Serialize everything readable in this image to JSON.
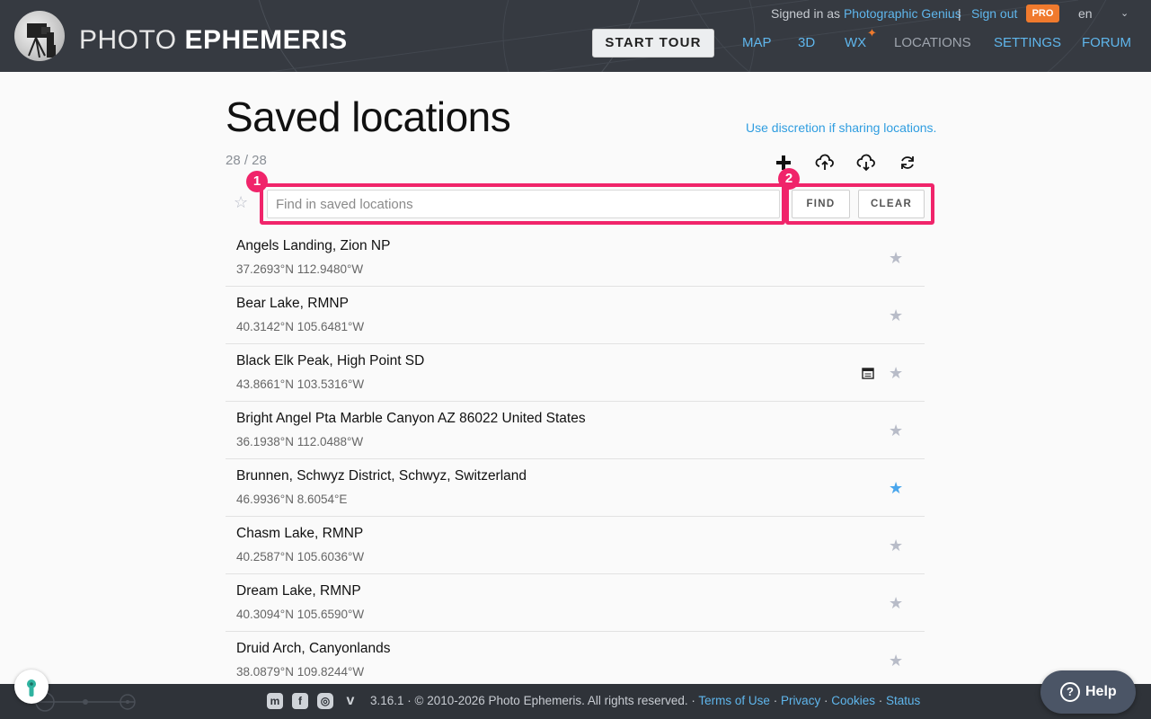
{
  "header": {
    "brand_light": "PHOTO",
    "brand_bold": "EPHEMERIS",
    "signed_in_prefix": "Signed in as",
    "user": "Photographic Genius",
    "separator": "|",
    "sign_out": "Sign out",
    "pro_badge": "PRO",
    "language": "en",
    "start_tour": "START TOUR",
    "nav": [
      {
        "label": "MAP",
        "active": false
      },
      {
        "label": "3D",
        "active": false
      },
      {
        "label": "WX",
        "active": false
      },
      {
        "label": "LOCATIONS",
        "active": true
      },
      {
        "label": "SETTINGS",
        "active": false
      },
      {
        "label": "FORUM",
        "active": false
      }
    ],
    "wx_new_marker": "✦"
  },
  "main": {
    "title": "Saved locations",
    "discretion_link": "Use discretion if sharing locations.",
    "count": "28 / 28",
    "toolbar_icons": [
      "plus-icon",
      "cloud-upload-icon",
      "cloud-download-icon",
      "refresh-icon"
    ],
    "search": {
      "placeholder": "Find in saved locations",
      "value": ""
    },
    "find_label": "FIND",
    "clear_label": "CLEAR",
    "annotations": [
      "1",
      "2"
    ]
  },
  "locations": [
    {
      "name": "Angels Landing, Zion NP",
      "coords": "37.2693°N 112.9480°W",
      "favorite": false,
      "calendar": false
    },
    {
      "name": "Bear Lake, RMNP",
      "coords": "40.3142°N 105.6481°W",
      "favorite": false,
      "calendar": false
    },
    {
      "name": "Black Elk Peak, High Point SD",
      "coords": "43.8661°N 103.5316°W",
      "favorite": false,
      "calendar": true
    },
    {
      "name": "Bright Angel Pta Marble Canyon AZ 86022 United States",
      "coords": "36.1938°N 112.0488°W",
      "favorite": false,
      "calendar": false
    },
    {
      "name": "Brunnen, Schwyz District, Schwyz, Switzerland",
      "coords": "46.9936°N 8.6054°E",
      "favorite": true,
      "calendar": false
    },
    {
      "name": "Chasm Lake, RMNP",
      "coords": "40.2587°N 105.6036°W",
      "favorite": false,
      "calendar": false
    },
    {
      "name": "Dream Lake, RMNP",
      "coords": "40.3094°N 105.6590°W",
      "favorite": false,
      "calendar": false
    },
    {
      "name": "Druid Arch, Canyonlands",
      "coords": "38.0879°N 109.8244°W",
      "favorite": false,
      "calendar": false
    }
  ],
  "footer": {
    "social_icons": [
      "mastodon-icon",
      "facebook-icon",
      "instagram-icon",
      "vimeo-icon"
    ],
    "copyright": "3.16.1 · © 2010-2026 Photo Ephemeris. All rights reserved. ·",
    "links": [
      "Terms of Use",
      "Privacy",
      "Cookies",
      "Status"
    ],
    "link_separator": " · "
  },
  "help_label": "Help",
  "colors": {
    "accent": "#5fb6ec",
    "highlight": "#f0246a",
    "pro": "#f07a2d",
    "header_bg": "#363a41",
    "favorite_star": "#4aa6ec"
  }
}
